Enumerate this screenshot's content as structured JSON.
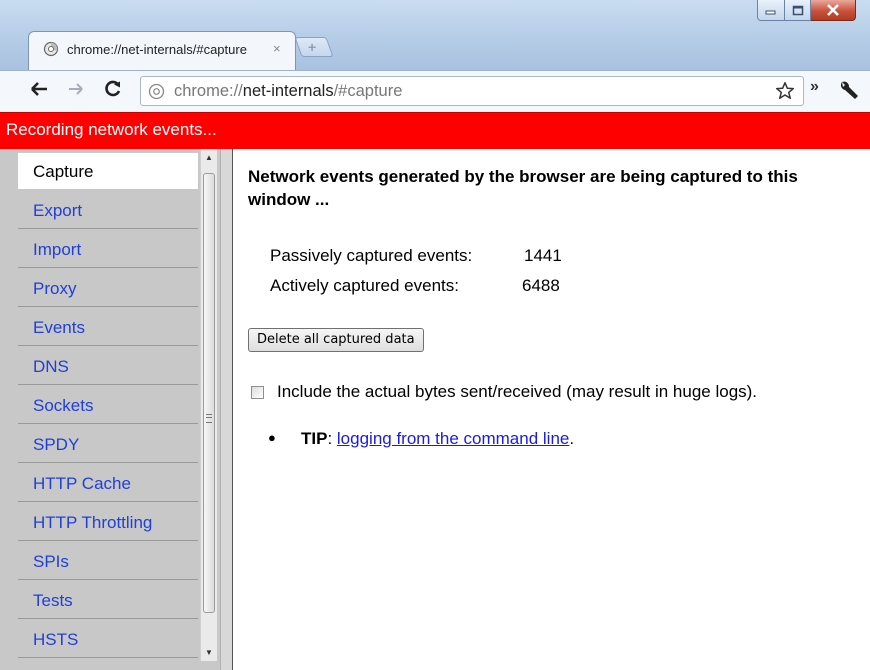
{
  "tab": {
    "title": "chrome://net-internals/#capture",
    "close_glyph": "×",
    "new_tab_glyph": "+"
  },
  "omnibox": {
    "scheme": "chrome://",
    "host": "net-internals",
    "path": "/#capture"
  },
  "toolbar": {
    "back_icon": "back-arrow-icon",
    "forward_icon": "forward-arrow-icon",
    "reload_icon": "reload-icon",
    "bookmark_icon": "star-icon",
    "overflow_glyph": "»",
    "menu_icon": "wrench-icon"
  },
  "banner": {
    "text": "Recording network events...",
    "color": "#ff0000"
  },
  "sidebar": {
    "items": [
      {
        "label": "Capture",
        "active": true
      },
      {
        "label": "Export",
        "active": false
      },
      {
        "label": "Import",
        "active": false
      },
      {
        "label": "Proxy",
        "active": false
      },
      {
        "label": "Events",
        "active": false
      },
      {
        "label": "DNS",
        "active": false
      },
      {
        "label": "Sockets",
        "active": false
      },
      {
        "label": "SPDY",
        "active": false
      },
      {
        "label": "HTTP Cache",
        "active": false
      },
      {
        "label": "HTTP Throttling",
        "active": false
      },
      {
        "label": "SPIs",
        "active": false
      },
      {
        "label": "Tests",
        "active": false
      },
      {
        "label": "HSTS",
        "active": false
      }
    ]
  },
  "capture": {
    "heading": "Network events generated by the browser are being captured to this window ...",
    "passive_label": "Passively captured events:",
    "passive_count": "1441",
    "active_label": "Actively captured events:",
    "active_count": "6488",
    "delete_button": "Delete all captured data",
    "include_bytes_label": "Include the actual bytes sent/received (may result in huge logs).",
    "include_bytes_checked": false,
    "tip_label": "TIP",
    "tip_separator": ": ",
    "tip_link": "logging from the command line",
    "tip_end": "."
  },
  "colors": {
    "link": "#1f3fd8",
    "sidebar_bg": "#c8c8c8"
  }
}
